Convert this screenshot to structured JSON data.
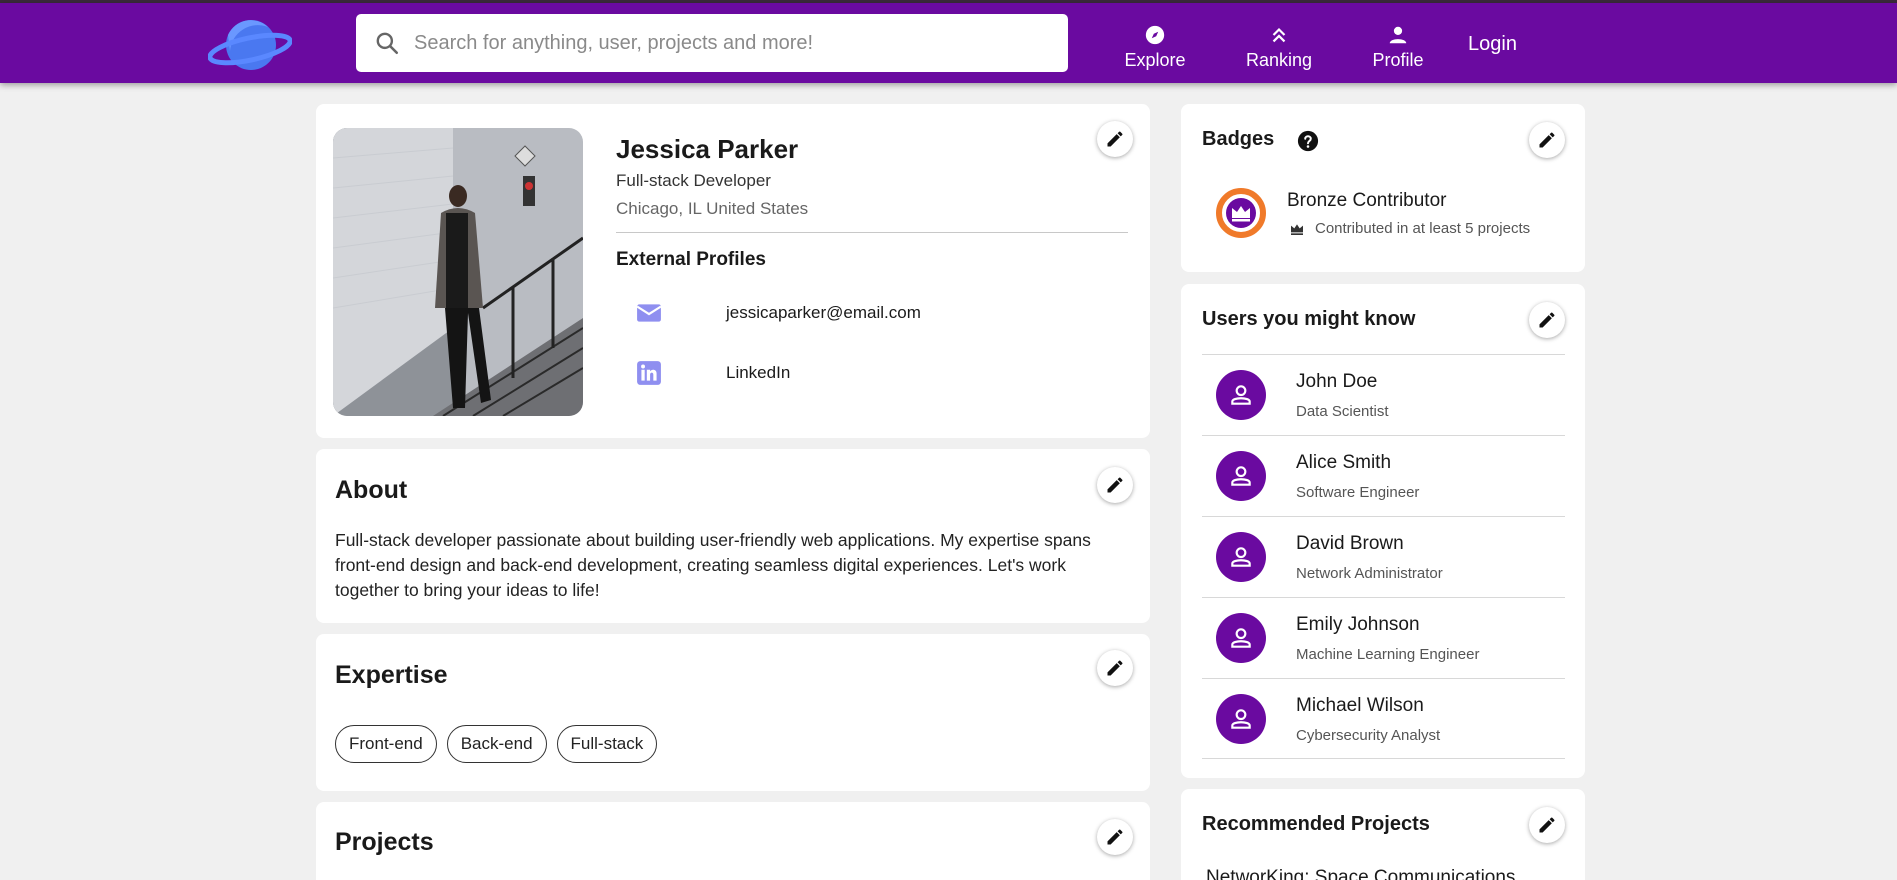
{
  "colors": {
    "brand": "#6a0aa0",
    "badge": "#f07a2a"
  },
  "navbar": {
    "search_placeholder": "Search for anything, user, projects and more!",
    "items": [
      {
        "label": "Explore",
        "icon": "compass-icon"
      },
      {
        "label": "Ranking",
        "icon": "double-chevron-up-icon"
      },
      {
        "label": "Profile",
        "icon": "person-icon"
      }
    ],
    "login_label": "Login"
  },
  "profile": {
    "name": "Jessica Parker",
    "role": "Full-stack Developer",
    "location": "Chicago, IL United States",
    "external_title": "External Profiles",
    "external": [
      {
        "icon": "email-icon",
        "label": "jessicaparker@email.com"
      },
      {
        "icon": "linkedin-icon",
        "label": "LinkedIn"
      }
    ]
  },
  "about": {
    "title": "About",
    "text": "Full-stack developer passionate about building user-friendly web applications. My expertise spans front-end design and back-end development, creating seamless digital experiences. Let's work together to bring your ideas to life!"
  },
  "expertise": {
    "title": "Expertise",
    "chips": [
      "Front-end",
      "Back-end",
      "Full-stack"
    ]
  },
  "projects": {
    "title": "Projects"
  },
  "badges": {
    "title": "Badges",
    "items": [
      {
        "name": "Bronze Contributor",
        "description": "Contributed in at least 5 projects"
      }
    ]
  },
  "users": {
    "title": "Users you might know",
    "items": [
      {
        "name": "John Doe",
        "role": "Data Scientist"
      },
      {
        "name": "Alice Smith",
        "role": "Software Engineer"
      },
      {
        "name": "David Brown",
        "role": "Network Administrator"
      },
      {
        "name": "Emily Johnson",
        "role": "Machine Learning Engineer"
      },
      {
        "name": "Michael Wilson",
        "role": "Cybersecurity Analyst"
      }
    ]
  },
  "recommended": {
    "title": "Recommended Projects",
    "items": [
      "NetworKing: Space Communications"
    ]
  }
}
